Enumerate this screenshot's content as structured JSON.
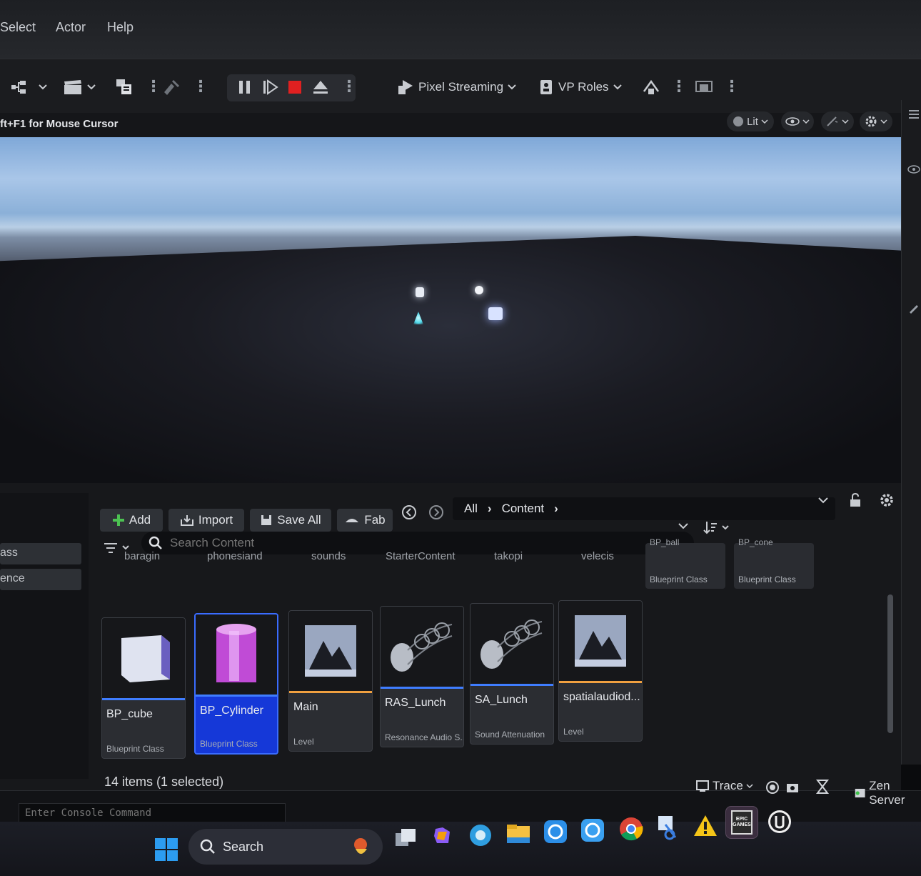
{
  "menu": {
    "items": [
      "Select",
      "Actor",
      "Help"
    ]
  },
  "toolbar": {
    "pixel_streaming_label": "Pixel Streaming",
    "vp_roles_label": "VP Roles"
  },
  "viewport": {
    "hint": "ft+F1 for Mouse Cursor",
    "lit_label": "Lit"
  },
  "content_browser": {
    "add_label": "Add",
    "import_label": "Import",
    "save_all_label": "Save All",
    "fab_label": "Fab",
    "breadcrumb": [
      "All",
      "Content"
    ],
    "search_placeholder": "Search Content",
    "left_items": [
      "ass",
      "ence"
    ],
    "folders": [
      "baragin",
      "phonesiand",
      "sounds",
      "StarterContent",
      "takopi",
      "velecis"
    ],
    "top_cards": [
      {
        "name": "BP_ball",
        "type": "Blueprint Class"
      },
      {
        "name": "BP_cone",
        "type": "Blueprint Class"
      }
    ],
    "assets": [
      {
        "name": "BP_cube",
        "type": "Blueprint Class",
        "selected": false,
        "bar_color": "#3f7dff"
      },
      {
        "name": "BP_Cylinder",
        "type": "Blueprint Class",
        "selected": true,
        "bar_color": "#3f7dff"
      },
      {
        "name": "Main",
        "type": "Level",
        "selected": false,
        "bar_color": "#f0a040"
      },
      {
        "name": "RAS_Lunch",
        "type": "Resonance Audio S...",
        "selected": false,
        "bar_color": "#3f7dff"
      },
      {
        "name": "SA_Lunch",
        "type": "Sound Attenuation",
        "selected": false,
        "bar_color": "#3f7dff"
      },
      {
        "name": "spatialaudiod...",
        "type": "Level",
        "selected": false,
        "bar_color": "#f0a040"
      }
    ],
    "status": "14 items (1 selected)"
  },
  "bottombar": {
    "console_placeholder": "Enter Console Command",
    "trace_label": "Trace",
    "zen_label": "Zen Server"
  },
  "taskbar": {
    "search_label": "Search",
    "epic_label": "EPIC GAMES"
  },
  "colors": {
    "selection": "#1538d8",
    "level_bar": "#f0a040",
    "blueprint_bar": "#3f7dff",
    "stop": "#e02020"
  }
}
